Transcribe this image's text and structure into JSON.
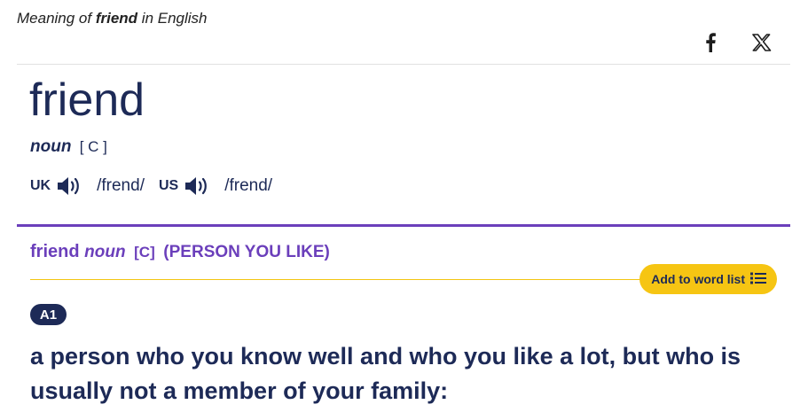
{
  "header": {
    "meaning_prefix": "Meaning of ",
    "headword": "friend",
    "meaning_suffix": " in English"
  },
  "share": {
    "icons": [
      "facebook-icon",
      "x-twitter-icon"
    ]
  },
  "entry": {
    "headword": "friend",
    "pos": "noun",
    "grammar": "[ C ]",
    "pronunciations": [
      {
        "region": "UK",
        "ipa": "/frend/"
      },
      {
        "region": "US",
        "ipa": "/frend/"
      }
    ]
  },
  "sense": {
    "headword": "friend",
    "pos": "noun",
    "grammar": "[C]",
    "guideword": "(PERSON YOU LIKE)",
    "add_label": "Add to word list",
    "level": "A1",
    "definition": "a person who you know well and who you like a lot, but who is usually not a member of your family:"
  },
  "colors": {
    "navy": "#1d2a57",
    "purple": "#6b3fbb",
    "yellow": "#f6c513"
  }
}
